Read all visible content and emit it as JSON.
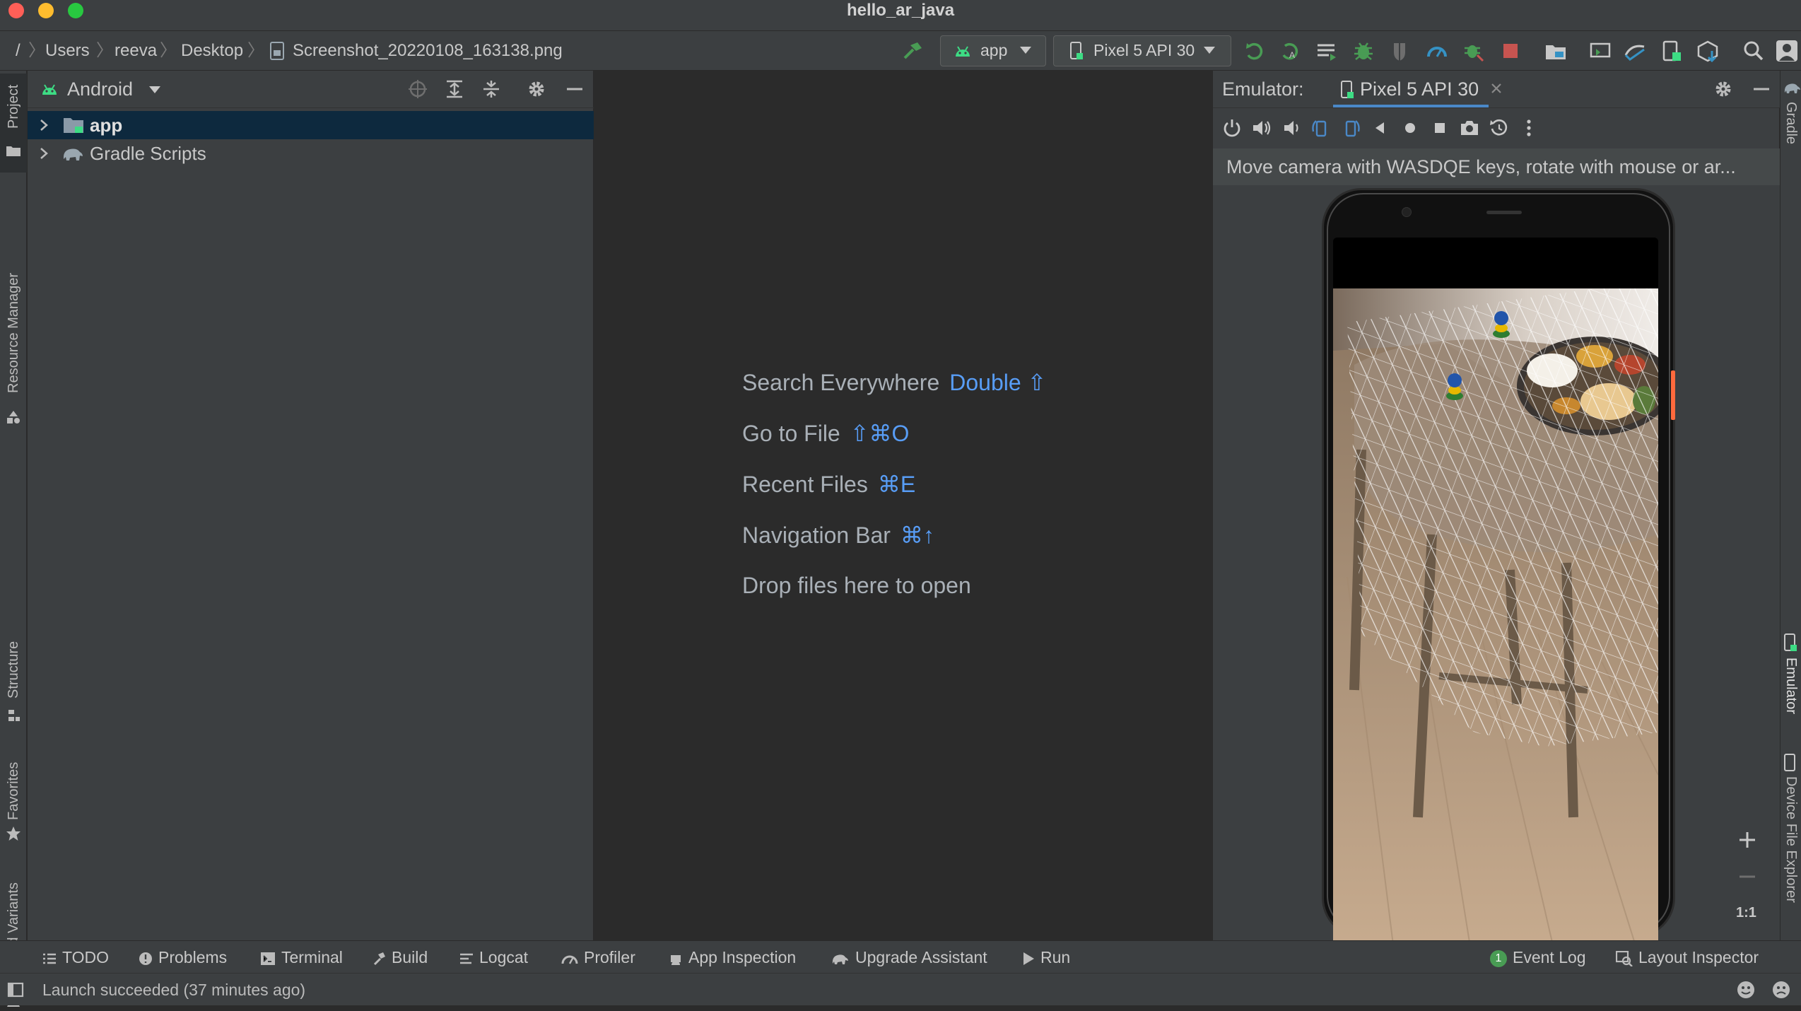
{
  "window": {
    "title": "hello_ar_java"
  },
  "breadcrumb": {
    "root": "/",
    "items": [
      "Users",
      "reeva",
      "Desktop",
      "Screenshot_20220108_163138.png"
    ]
  },
  "toolbar": {
    "run_config": "app",
    "device": "Pixel 5 API 30"
  },
  "left_tabs": [
    "Project",
    "Resource Manager",
    "Structure",
    "Favorites",
    "Build Variants"
  ],
  "right_tabs": [
    "Gradle",
    "Emulator",
    "Device File Explorer"
  ],
  "project_panel": {
    "view_selector": "Android",
    "tree": [
      {
        "label": "app",
        "selected": true
      },
      {
        "label": "Gradle Scripts",
        "selected": false
      }
    ]
  },
  "editor_hints": [
    {
      "label": "Search Everywhere",
      "shortcut": "Double ⇧"
    },
    {
      "label": "Go to File",
      "shortcut": "⇧⌘O"
    },
    {
      "label": "Recent Files",
      "shortcut": "⌘E"
    },
    {
      "label": "Navigation Bar",
      "shortcut": "⌘↑"
    },
    {
      "label": "Drop files here to open",
      "shortcut": ""
    }
  ],
  "emulator": {
    "label": "Emulator:",
    "tab": "Pixel 5 API 30",
    "hint": "Move camera with WASDQE keys, rotate with mouse or ar...",
    "zoom_one_to_one": "1:1"
  },
  "bottom_tools": [
    "TODO",
    "Problems",
    "Terminal",
    "Build",
    "Logcat",
    "Profiler",
    "App Inspection",
    "Upgrade Assistant",
    "Run"
  ],
  "bottom_right": {
    "event_log": "Event Log",
    "event_log_count": "1",
    "layout_inspector": "Layout Inspector"
  },
  "status": {
    "text": "Launch succeeded (37 minutes ago)"
  },
  "colors": {
    "accent_green": "#499c54",
    "link_blue": "#589df6",
    "selection": "#0d293e",
    "stop_red": "#c75450"
  }
}
